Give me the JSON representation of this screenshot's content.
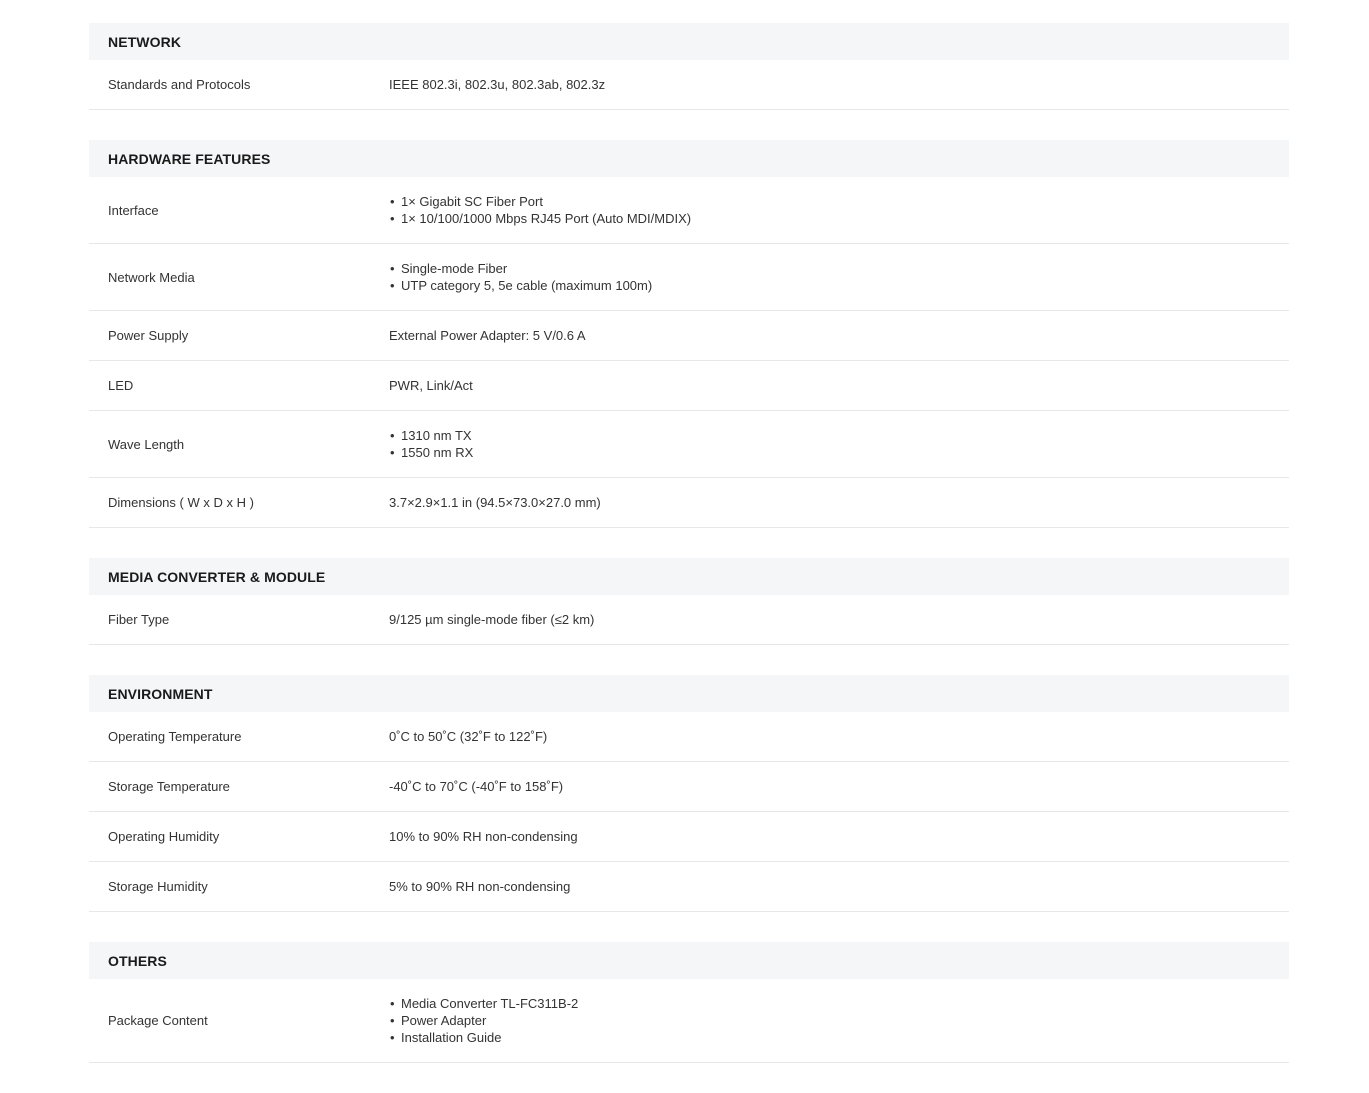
{
  "sections": [
    {
      "title": "NETWORK",
      "rows": [
        {
          "label": "Standards and Protocols",
          "value": "IEEE 802.3i, 802.3u, 802.3ab, 802.3z"
        }
      ]
    },
    {
      "title": "HARDWARE FEATURES",
      "rows": [
        {
          "label": "Interface",
          "items": [
            "1× Gigabit SC Fiber Port",
            "1× 10/100/1000 Mbps RJ45 Port (Auto MDI/MDIX)"
          ]
        },
        {
          "label": "Network Media",
          "items": [
            "Single-mode Fiber",
            "UTP category 5, 5e cable (maximum 100m)"
          ]
        },
        {
          "label": "Power Supply",
          "value": "External Power Adapter: 5 V/0.6 A"
        },
        {
          "label": "LED",
          "value": "PWR, Link/Act"
        },
        {
          "label": "Wave Length",
          "items": [
            "1310 nm TX",
            "1550 nm RX"
          ]
        },
        {
          "label": "Dimensions ( W x D x H )",
          "value": "3.7×2.9×1.1 in (94.5×73.0×27.0 mm)"
        }
      ]
    },
    {
      "title": "MEDIA CONVERTER & MODULE",
      "rows": [
        {
          "label": "Fiber Type",
          "value": "9/125 µm single-mode fiber (≤2 km)"
        }
      ]
    },
    {
      "title": "ENVIRONMENT",
      "rows": [
        {
          "label": "Operating Temperature",
          "value": "0˚C to 50˚C (32˚F to 122˚F)"
        },
        {
          "label": "Storage Temperature",
          "value": "-40˚C to 70˚C (-40˚F to 158˚F)"
        },
        {
          "label": "Operating Humidity",
          "value": "10% to 90% RH non-condensing"
        },
        {
          "label": "Storage Humidity",
          "value": "5% to 90% RH non-condensing"
        }
      ]
    },
    {
      "title": "OTHERS",
      "rows": [
        {
          "label": "Package Content",
          "items": [
            "Media Converter TL-FC311B-2",
            "Power Adapter",
            "Installation Guide"
          ]
        }
      ]
    }
  ]
}
